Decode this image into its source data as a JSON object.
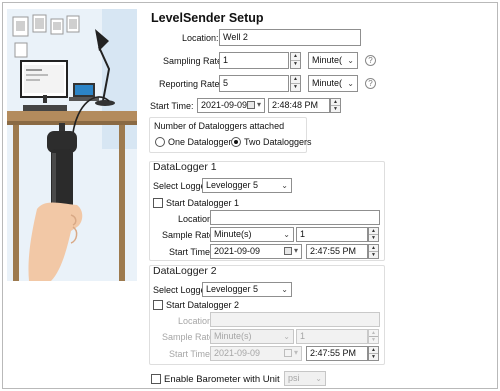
{
  "window": {
    "title": "LevelSender Setup"
  },
  "location": {
    "label": "Location:",
    "value": "Well 2"
  },
  "sampling_rate": {
    "label": "Sampling Rate:",
    "value": "1",
    "unit": "Minute(",
    "help_icon": "question-circle-icon"
  },
  "reporting_rate": {
    "label": "Reporting Rate:",
    "value": "5",
    "unit": "Minute(",
    "help_icon": "question-circle-icon"
  },
  "start_time": {
    "label": "Start Time:",
    "date": "2021-09-09",
    "time": "2:48:48 PM"
  },
  "dataloggers_group": {
    "label": "Number of Dataloggers attached",
    "options": [
      "One Datalogger",
      "Two Dataloggers"
    ],
    "selected": "Two Dataloggers"
  },
  "datalogger1": {
    "heading": "DataLogger 1",
    "select_logger_label": "Select Logger",
    "select_logger_value": "Levelogger 5",
    "start_label": "Start Datalogger 1",
    "start_checked": false,
    "location_label": "Location",
    "location_value": "",
    "sample_rate_label": "Sample Rate",
    "sample_rate_unit": "Minute(s)",
    "sample_rate_value": "1",
    "start_time_label": "Start Time",
    "start_date": "2021-09-09",
    "start_time": "2:47:55 PM",
    "enabled": true
  },
  "datalogger2": {
    "heading": "DataLogger 2",
    "select_logger_label": "Select Logger",
    "select_logger_value": "Levelogger 5",
    "start_label": "Start Datalogger 2",
    "start_checked": false,
    "location_label": "Location",
    "location_value": "",
    "sample_rate_label": "Sample Rate",
    "sample_rate_unit": "Minute(s)",
    "sample_rate_value": "1",
    "start_time_label": "Start Time",
    "start_date": "2021-09-09",
    "start_time": "2:47:55 PM",
    "enabled": false
  },
  "barometer": {
    "label": "Enable Barometer with Unit",
    "checked": false,
    "unit": "psi"
  },
  "icons": {
    "dropdown": "chevron-down-icon",
    "calendar": "calendar-icon",
    "spinner": "spin-arrows-icon"
  }
}
